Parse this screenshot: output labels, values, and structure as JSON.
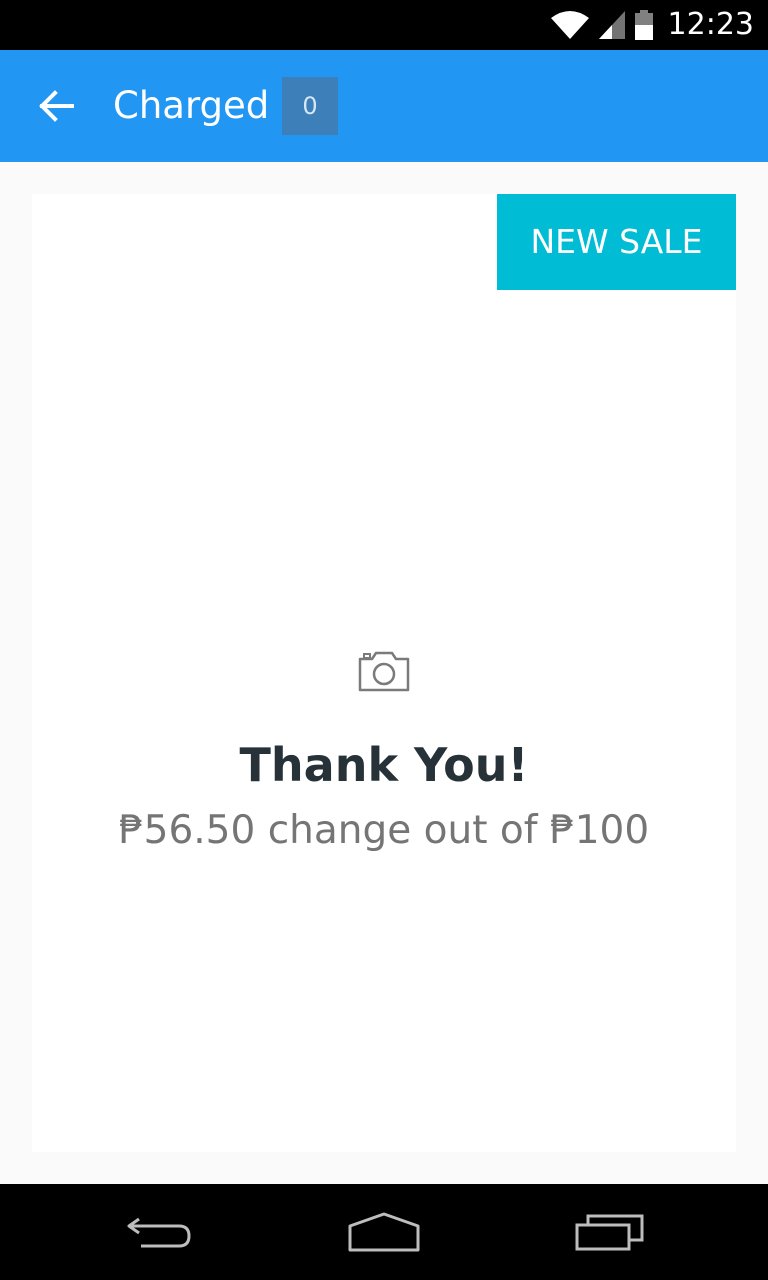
{
  "status_bar": {
    "time": "12:23",
    "icons": [
      "wifi-icon",
      "signal-icon",
      "battery-icon"
    ]
  },
  "app_bar": {
    "title": "Charged",
    "badge_count": "0",
    "back_icon": "arrow-back-icon",
    "color": "#2196f3"
  },
  "card": {
    "new_sale_label": "NEW SALE",
    "new_sale_color": "#00bcd4",
    "photo_icon": "camera-icon",
    "heading": "Thank You!",
    "message": "₱56.50 change out of ₱100"
  },
  "nav_bar": {
    "icons": [
      "back-icon",
      "home-icon",
      "recents-icon"
    ]
  }
}
